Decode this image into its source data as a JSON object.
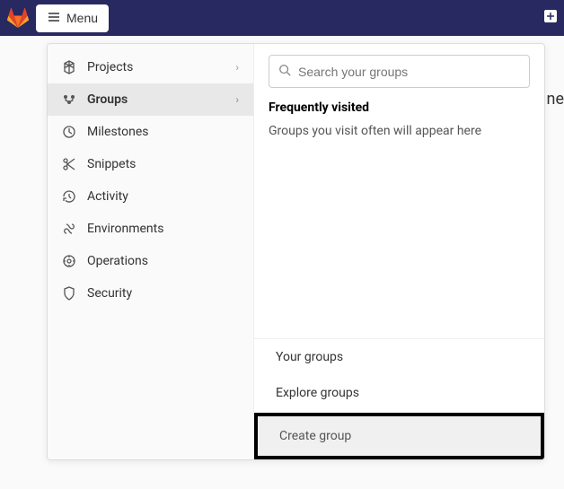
{
  "topbar": {
    "menu_label": "Menu"
  },
  "sidebar": {
    "items": [
      {
        "label": "Projects",
        "active": false,
        "has_chevron": true
      },
      {
        "label": "Groups",
        "active": true,
        "has_chevron": true
      },
      {
        "label": "Milestones",
        "active": false,
        "has_chevron": false
      },
      {
        "label": "Snippets",
        "active": false,
        "has_chevron": false
      },
      {
        "label": "Activity",
        "active": false,
        "has_chevron": false
      },
      {
        "label": "Environments",
        "active": false,
        "has_chevron": false
      },
      {
        "label": "Operations",
        "active": false,
        "has_chevron": false
      },
      {
        "label": "Security",
        "active": false,
        "has_chevron": false
      }
    ]
  },
  "main": {
    "search_placeholder": "Search your groups",
    "frequent_title": "Frequently visited",
    "frequent_text": "Groups you visit often will appear here",
    "your_groups": "Your groups",
    "explore_groups": "Explore groups",
    "create_group": "Create group"
  },
  "behind": {
    "text": "ne"
  }
}
